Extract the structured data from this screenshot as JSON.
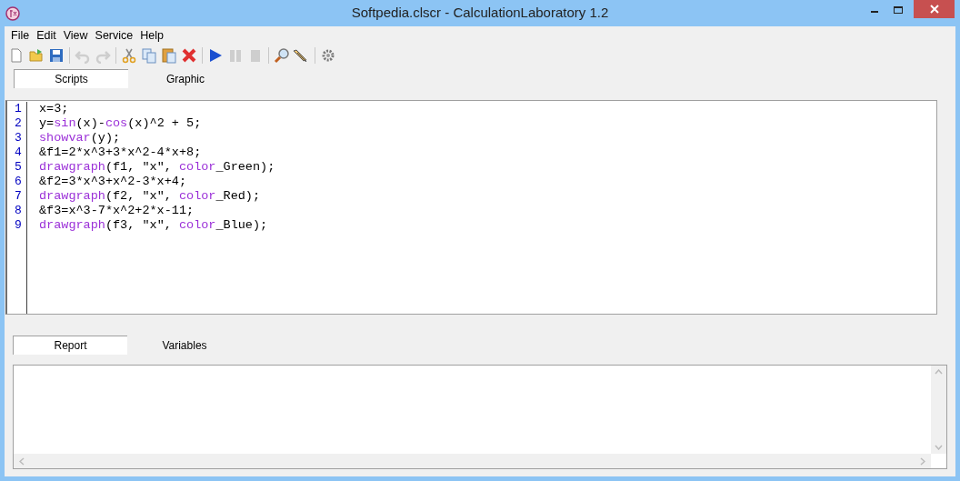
{
  "window": {
    "title": "Softpedia.clscr - CalculationLaboratory 1.2"
  },
  "menu": [
    "File",
    "Edit",
    "View",
    "Service",
    "Help"
  ],
  "toolbar": [
    [
      {
        "kind": "new",
        "disabled": false
      },
      {
        "kind": "open",
        "disabled": false
      },
      {
        "kind": "save",
        "disabled": false
      }
    ],
    [
      {
        "kind": "undo",
        "disabled": true
      },
      {
        "kind": "redo",
        "disabled": true
      }
    ],
    [
      {
        "kind": "cut",
        "disabled": false
      },
      {
        "kind": "copy",
        "disabled": false
      },
      {
        "kind": "paste",
        "disabled": false
      },
      {
        "kind": "delete",
        "disabled": false
      }
    ],
    [
      {
        "kind": "run",
        "disabled": false
      },
      {
        "kind": "pause",
        "disabled": true
      },
      {
        "kind": "stop",
        "disabled": true
      }
    ],
    [
      {
        "kind": "find",
        "disabled": false
      },
      {
        "kind": "edit",
        "disabled": false
      }
    ],
    [
      {
        "kind": "settings",
        "disabled": false
      }
    ]
  ],
  "top_tabs": [
    {
      "label": "Scripts",
      "selected": true
    },
    {
      "label": "Graphic",
      "selected": false
    }
  ],
  "editor": {
    "lines": [
      {
        "number": "1",
        "tokens": [
          {
            "text": "x=3;",
            "kind": "plain"
          }
        ]
      },
      {
        "number": "2",
        "tokens": [
          {
            "text": "y=",
            "kind": "plain"
          },
          {
            "text": "sin",
            "kind": "keyword"
          },
          {
            "text": "(x)-",
            "kind": "plain"
          },
          {
            "text": "cos",
            "kind": "keyword"
          },
          {
            "text": "(x)^2 + 5;",
            "kind": "plain"
          }
        ]
      },
      {
        "number": "3",
        "tokens": [
          {
            "text": "showvar",
            "kind": "keyword"
          },
          {
            "text": "(y);",
            "kind": "plain"
          }
        ]
      },
      {
        "number": "4",
        "tokens": [
          {
            "text": "&f1=2*x^3+3*x^2-4*x+8;",
            "kind": "plain"
          }
        ]
      },
      {
        "number": "5",
        "tokens": [
          {
            "text": "drawgraph",
            "kind": "keyword"
          },
          {
            "text": "(f1, \"x\", ",
            "kind": "plain"
          },
          {
            "text": "color",
            "kind": "keyword"
          },
          {
            "text": "_Green);",
            "kind": "plain"
          }
        ]
      },
      {
        "number": "6",
        "tokens": [
          {
            "text": "&f2=3*x^3+x^2-3*x+4;",
            "kind": "plain"
          }
        ]
      },
      {
        "number": "7",
        "tokens": [
          {
            "text": "drawgraph",
            "kind": "keyword"
          },
          {
            "text": "(f2, \"x\", ",
            "kind": "plain"
          },
          {
            "text": "color",
            "kind": "keyword"
          },
          {
            "text": "_Red);",
            "kind": "plain"
          }
        ]
      },
      {
        "number": "8",
        "tokens": [
          {
            "text": "&f3=x^3-7*x^2+2*x-11;",
            "kind": "plain"
          }
        ]
      },
      {
        "number": "9",
        "tokens": [
          {
            "text": "drawgraph",
            "kind": "keyword"
          },
          {
            "text": "(f3, \"x\", ",
            "kind": "plain"
          },
          {
            "text": "color",
            "kind": "keyword"
          },
          {
            "text": "_Blue);",
            "kind": "plain"
          }
        ]
      }
    ]
  },
  "bottom_tabs": [
    {
      "label": "Report",
      "selected": true
    },
    {
      "label": "Variables",
      "selected": false
    }
  ]
}
